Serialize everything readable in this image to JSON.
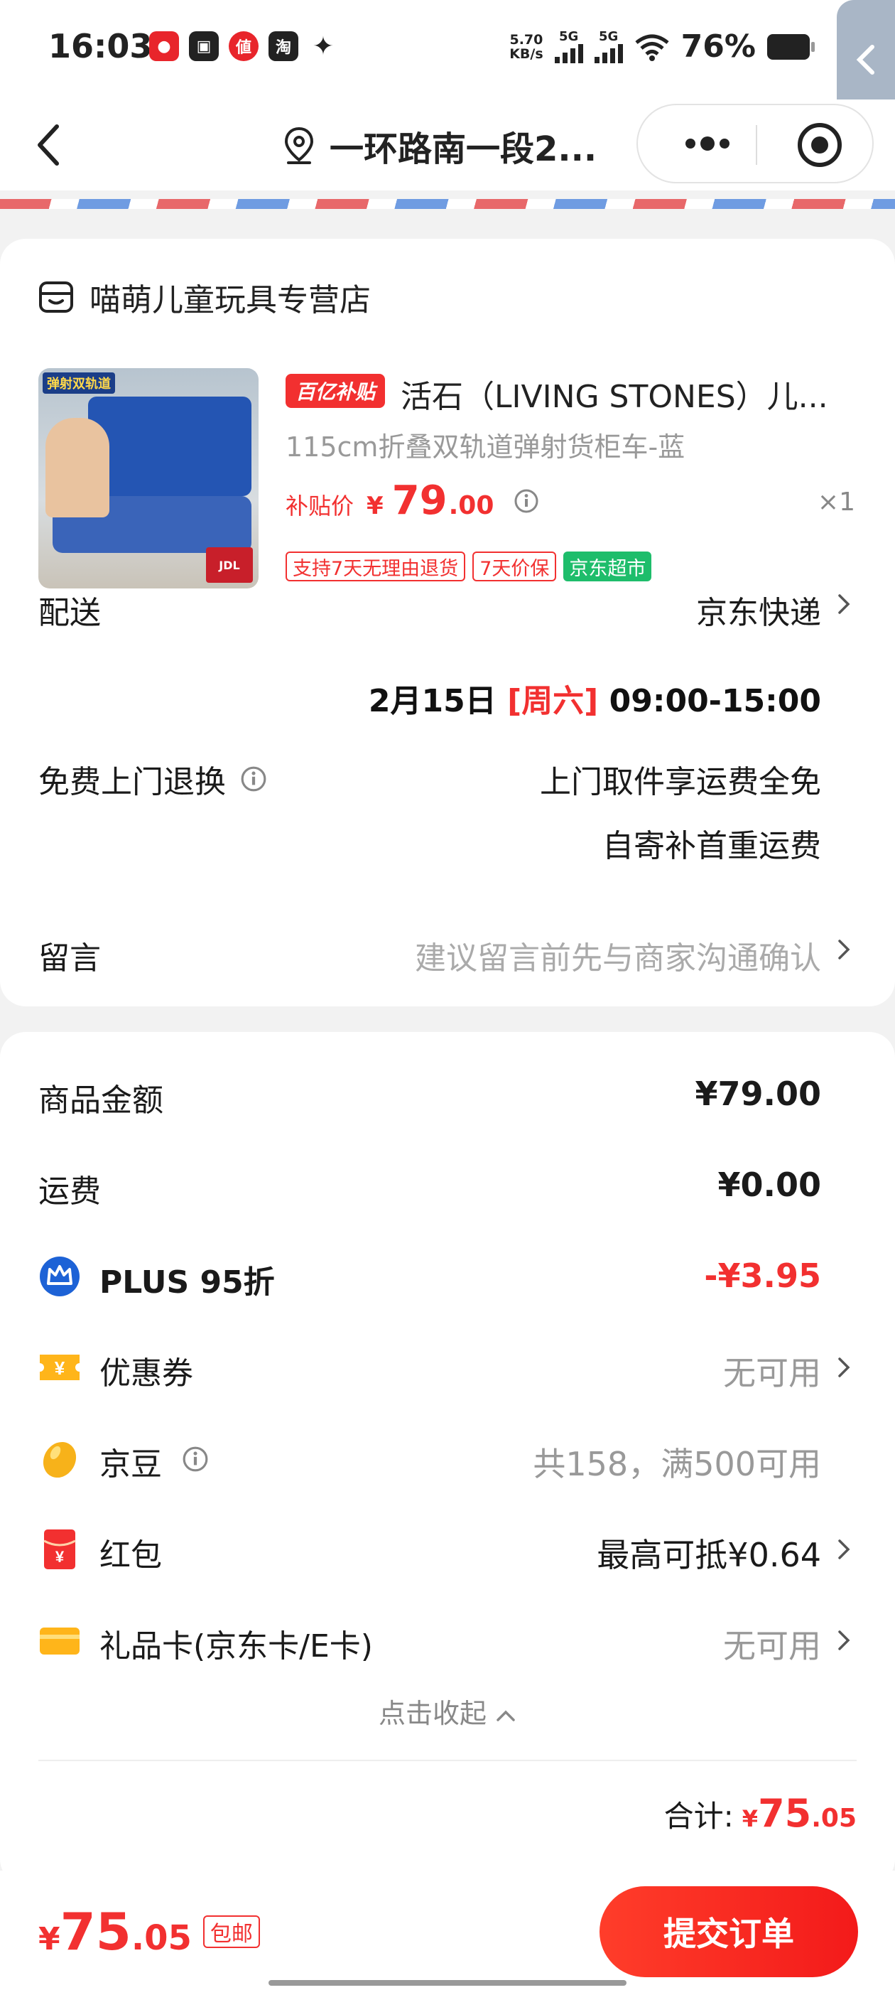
{
  "status_bar": {
    "time": "16:03",
    "net_speed_value": "5.70",
    "net_speed_unit": "KB/s",
    "signal1_label": "5G",
    "signal2_label": "5G",
    "battery_text": "76%"
  },
  "nav": {
    "address": "一环路南一段2..."
  },
  "order_card": {
    "shop_name": "喵萌儿童玩具专营店",
    "subsidy_tag": "百亿补贴",
    "product_title": "活石（LIVING STONES）儿...",
    "product_spec": "115cm折叠双轨道弹射货柜车-蓝",
    "price_label": "补贴价",
    "price_symbol": "¥",
    "price_int": "79",
    "price_dec": ".00",
    "quantity": "×1",
    "badges": [
      "支持7天无理由退货",
      "7天价保",
      "京东超市"
    ],
    "thumb_banner": "弹射双轨道",
    "thumb_badge": "JDL"
  },
  "delivery": {
    "label": "配送",
    "method": "京东快递",
    "date": "2月15日",
    "weekday": "[周六]",
    "time_range": "09:00-15:00"
  },
  "returns": {
    "label": "免费上门退换",
    "line1": "上门取件享运费全免",
    "line2": "自寄补首重运费"
  },
  "message": {
    "label": "留言",
    "hint": "建议留言前先与商家沟通确认"
  },
  "summary": {
    "goods_amount_label": "商品金额",
    "goods_amount": "¥79.00",
    "shipping_label": "运费",
    "shipping": "¥0.00",
    "plus_label": "PLUS 95折",
    "plus_discount": "-¥3.95",
    "coupon_label": "优惠券",
    "coupon_value": "无可用",
    "jingdou_label": "京豆",
    "jingdou_value": "共158，满500可用",
    "hongbao_label": "红包",
    "hongbao_value": "最高可抵¥0.64",
    "giftcard_label": "礼品卡(京东卡/E卡)",
    "giftcard_value": "无可用",
    "collapse_label": "点击收起",
    "total_label": "合计:",
    "total_symbol": "¥",
    "total_int": "75",
    "total_dec": ".05"
  },
  "bottom_bar": {
    "price_symbol": "¥",
    "price_int": "75",
    "price_dec": ".05",
    "free_shipping": "包邮",
    "submit_label": "提交订单"
  },
  "colors": {
    "accent_red": "#f23030",
    "green_badge": "#1ebd6b"
  }
}
